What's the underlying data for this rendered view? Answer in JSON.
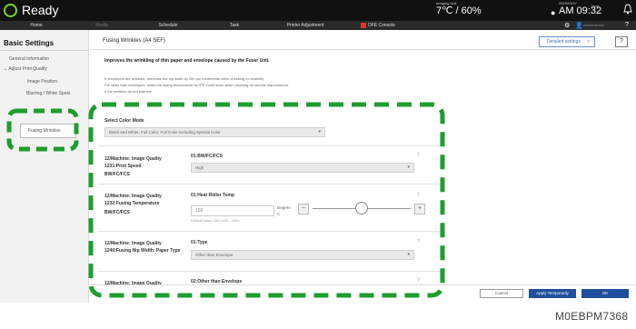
{
  "app": {
    "title": "Ready"
  },
  "status": {
    "imaging_label": "Imaging Unit",
    "imaging_value": "7℃ / 60%",
    "date_label": "2023/03/27",
    "time_value": "AM 09:32",
    "host_label": "Host"
  },
  "nav": {
    "tabs": [
      {
        "label": "Home"
      },
      {
        "label": "Media"
      },
      {
        "label": "Schedule"
      },
      {
        "label": "Task"
      },
      {
        "label": "Printer Adjustment"
      },
      {
        "label": "DFE Console"
      }
    ],
    "user_label": "Administrator",
    "help_label": "?"
  },
  "sidebar": {
    "header": "Basic Settings",
    "items": [
      {
        "label": "General Information"
      },
      {
        "label": "Adjust Print Quality"
      },
      {
        "label": "Image Position"
      },
      {
        "label": "Blurring / White Spots"
      },
      {
        "label": "Fusing Wrinkles"
      }
    ]
  },
  "main": {
    "title": "Fusing Wrinkles (A4 SEF)",
    "detail_button": "Detailed settings",
    "detail_chevron": ">",
    "help_button": "?",
    "intro": "Improves the wrinkling of thin paper and envelope caused by the Fuser Unit.",
    "notes": [
      "If envelopes are wrinkled, decrease the nip width by 250 µm increments while checking for fixability.",
      "For other than envelopes, lower the fusing temperature by 5℃ increments while checking for wrinkle improvement.",
      "If the wrinkles do not improve"
    ],
    "color_mode": {
      "label": "Select Color Mode",
      "value": "Black and White, Full Color, Full Color including Special Color"
    },
    "settings": [
      {
        "group": "12/Machine: Image Quality",
        "name": "1231:Print Speed",
        "sub": "BW/FC/FCS",
        "field_label": "01:BW/FC/FCS",
        "value": "High",
        "help": "?"
      },
      {
        "group": "12/Machine: Image Quality",
        "name": "1232:Fusing Temperature",
        "sub": "BW/FC/FCS",
        "field_label": "01:Heat Roller Temp",
        "value": "150",
        "unit_top": "Degree",
        "unit_bottom": "C",
        "minus": "−",
        "plus": "+",
        "default_note": "Default value:150 <100 - 200>",
        "slider_level": 0.5,
        "help": "?"
      },
      {
        "group": "12/Machine: Image Quality",
        "name": "1240:Fusing Nip Width: Paper Type",
        "sub": "",
        "field_label": "01:Type",
        "value": "Other than Envelope",
        "help": "?"
      },
      {
        "group": "12/Machine: Image Quality",
        "name": "",
        "sub": "",
        "field_label": "02:Other than Envelope",
        "value": "",
        "help": "?"
      }
    ]
  },
  "footer": {
    "cancel": "Cancel",
    "apply": "Apply Temporarily",
    "ok": "OK"
  },
  "figure_code": "M0EBPM7368",
  "colors": {
    "highlight": "#1f9d2f",
    "logo": "#7ed321",
    "primary": "#1f4f9c",
    "dfe_icon": "#e0332a"
  }
}
